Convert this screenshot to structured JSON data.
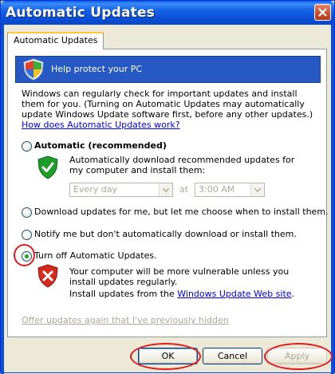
{
  "window": {
    "title": "Automatic Updates"
  },
  "tab": {
    "label": "Automatic Updates"
  },
  "banner": {
    "text": "Help protect your PC"
  },
  "intro": {
    "text": "Windows can regularly check for important updates and install them for you. (Turning on Automatic Updates may automatically update Windows Update software first, before any other updates.)",
    "link": "How does Automatic Updates work?"
  },
  "options": {
    "automatic": {
      "label": "Automatic (recommended)",
      "description": "Automatically download recommended updates for my computer and install them:",
      "day": "Every day",
      "at_label": "at",
      "time": "3:00 AM",
      "selected": false
    },
    "download": {
      "label": "Download updates for me, but let me choose when to install them.",
      "selected": false
    },
    "notify": {
      "label": "Notify me but don't automatically download or install them.",
      "selected": false
    },
    "turn_off": {
      "label": "Turn off Automatic Updates.",
      "warning": "Your computer will be more vulnerable unless you install updates regularly.",
      "install_prefix": "Install updates from the ",
      "install_link": "Windows Update Web site",
      "install_suffix": ".",
      "selected": true
    }
  },
  "offer_link": "Offer updates again that I've previously hidden",
  "buttons": {
    "ok": "OK",
    "cancel": "Cancel",
    "apply": "Apply"
  },
  "colors": {
    "titlebar": "#0a4fd6",
    "banner": "#2759c4",
    "annotation": "#e21a1a",
    "radio_dot": "#21a121"
  }
}
